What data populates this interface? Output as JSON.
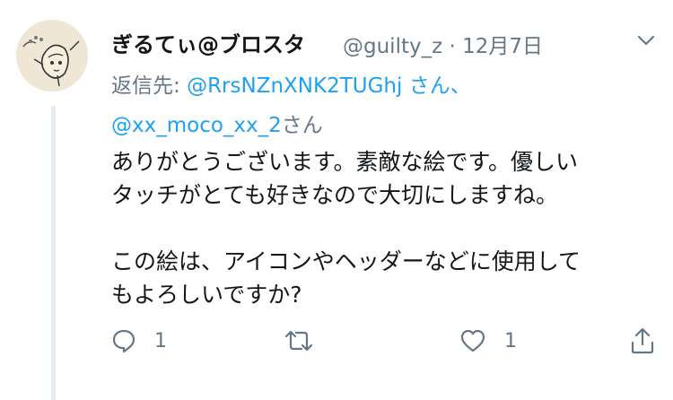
{
  "tweet": {
    "author_name": "ぎるてぃ@ブロスタ",
    "author_handle": "@guilty_z",
    "separator": "·",
    "date": "12月7日",
    "replying_to_label": "返信先:",
    "mentions": [
      "@RrsNZnXNK2TUGhj",
      "@xx_moco_xx_2"
    ],
    "mention_suffix_1": "さん、",
    "mention_suffix_2": "さん",
    "body_lines": [
      "ありがとうございます。素敵な絵です。優しい",
      "タッチがとても好きなので大切にしますね。",
      "この絵は、アイコンやヘッダーなどに使用して",
      "もよろしいですか?"
    ],
    "actions": {
      "reply_count": "1",
      "retweet_count": "",
      "like_count": "1"
    }
  },
  "icons": {
    "reply": "reply-icon",
    "retweet": "retweet-icon",
    "like": "heart-icon",
    "share": "share-icon",
    "menu": "chevron-down-icon"
  },
  "colors": {
    "text": "#14171a",
    "secondary": "#657786",
    "link": "#1da1f2",
    "thread_line": "#e6ecf0"
  }
}
